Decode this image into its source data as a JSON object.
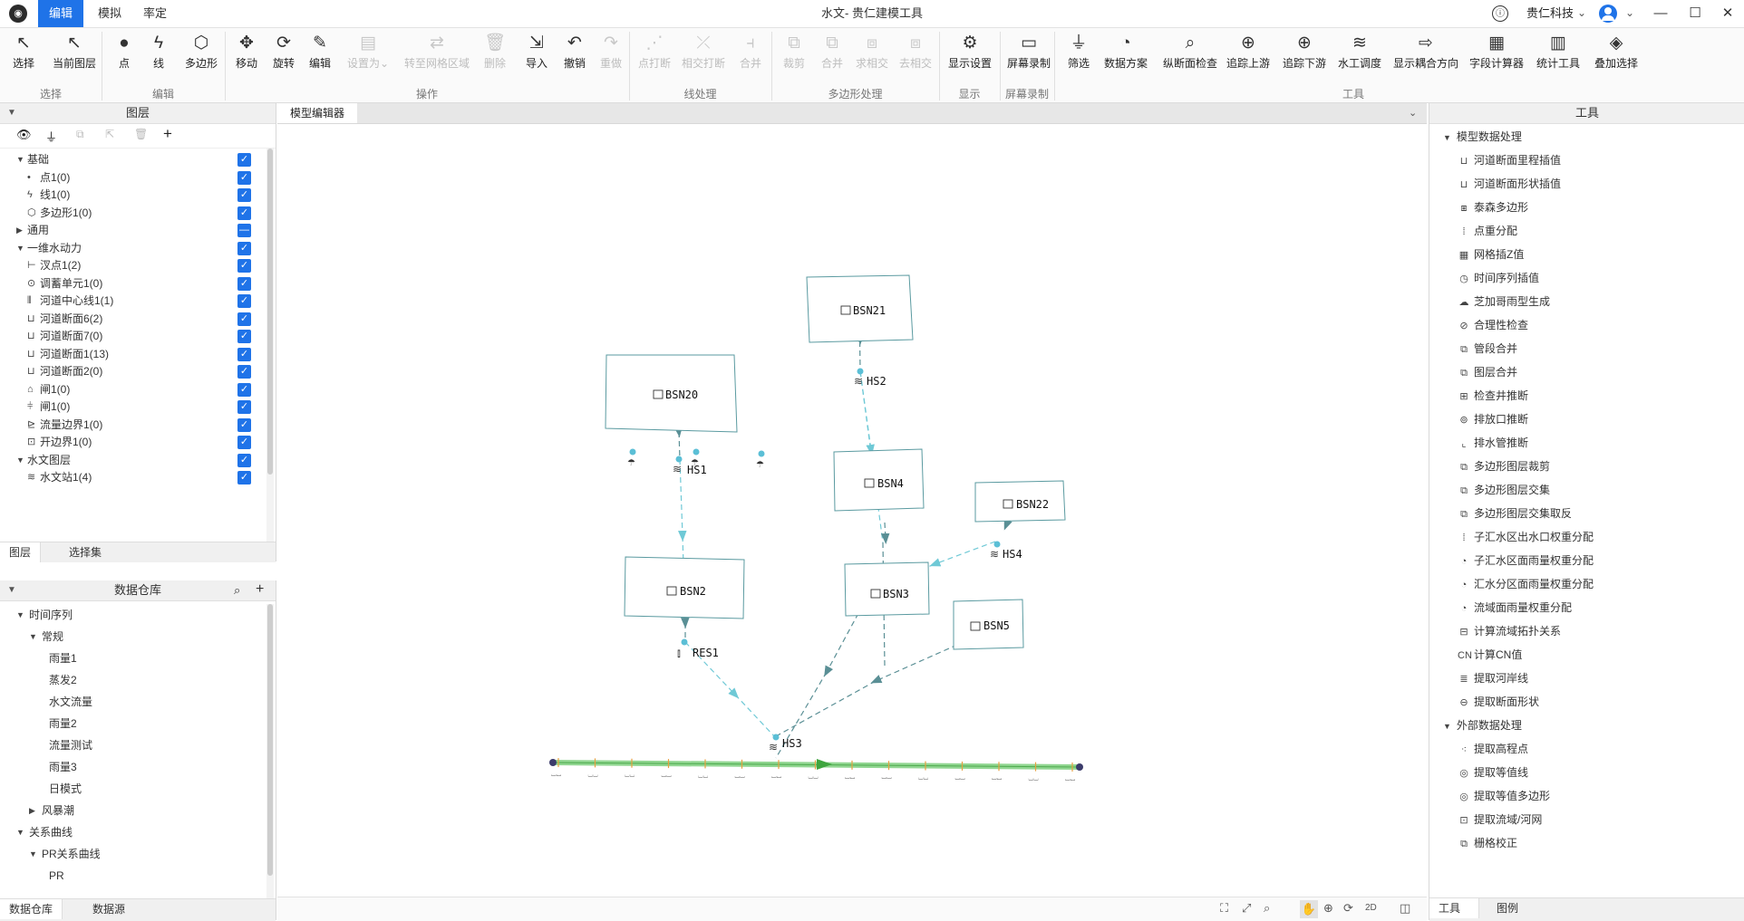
{
  "titlebar": {
    "menu": [
      "编辑",
      "模拟",
      "率定"
    ],
    "title": "水文- 贵仁建模工具",
    "company": "贵仁科技",
    "company_arrow": "⌄"
  },
  "ribbon": {
    "buttons": [
      {
        "label": "选择",
        "icon": "arrow-cursor-icon",
        "glyph": "↖",
        "disabled": false
      },
      {
        "label": "当前图层",
        "icon": "layer-cursor-icon",
        "glyph": "↖",
        "disabled": false
      },
      {
        "label": "点",
        "icon": "point-icon",
        "glyph": "●",
        "disabled": false
      },
      {
        "label": "线",
        "icon": "line-icon",
        "glyph": "ϟ",
        "disabled": false
      },
      {
        "label": "多边形",
        "icon": "polygon-icon",
        "glyph": "⬡",
        "disabled": false
      },
      {
        "label": "移动",
        "icon": "move-icon",
        "glyph": "✥",
        "disabled": false
      },
      {
        "label": "旋转",
        "icon": "rotate-icon",
        "glyph": "⟳",
        "disabled": false
      },
      {
        "label": "编辑",
        "icon": "pencil-icon",
        "glyph": "✎",
        "disabled": false
      },
      {
        "label": "设置为",
        "icon": "set-as-icon",
        "glyph": "▤",
        "disabled": true
      },
      {
        "label": "转至网格区域",
        "icon": "to-grid-icon",
        "glyph": "⇄",
        "disabled": true
      },
      {
        "label": "删除",
        "icon": "trash-icon",
        "glyph": "🗑",
        "disabled": true
      },
      {
        "label": "导入",
        "icon": "import-icon",
        "glyph": "⇲",
        "disabled": false
      },
      {
        "label": "撤销",
        "icon": "undo-icon",
        "glyph": "↶",
        "disabled": false
      },
      {
        "label": "重做",
        "icon": "redo-icon",
        "glyph": "↷",
        "disabled": true
      },
      {
        "label": "点打断",
        "icon": "point-break-icon",
        "glyph": "⋰",
        "disabled": true
      },
      {
        "label": "相交打断",
        "icon": "intersect-break-icon",
        "glyph": "⤫",
        "disabled": true
      },
      {
        "label": "合并",
        "icon": "merge-line-icon",
        "glyph": "⫞",
        "disabled": true
      },
      {
        "label": "裁剪",
        "icon": "clip-icon",
        "glyph": "⧉",
        "disabled": true
      },
      {
        "label": "合并",
        "icon": "merge-polygon-icon",
        "glyph": "⧉",
        "disabled": true
      },
      {
        "label": "求相交",
        "icon": "intersect-icon",
        "glyph": "⧈",
        "disabled": true
      },
      {
        "label": "去相交",
        "icon": "remove-intersect-icon",
        "glyph": "⧈",
        "disabled": true
      },
      {
        "label": "显示设置",
        "icon": "gear-icon",
        "glyph": "⚙",
        "disabled": false
      },
      {
        "label": "屏幕录制",
        "icon": "video-icon",
        "glyph": "▭",
        "disabled": false
      },
      {
        "label": "筛选",
        "icon": "filter-icon",
        "glyph": "⏚",
        "disabled": false
      },
      {
        "label": "数据方案",
        "icon": "pie-icon",
        "glyph": "◔",
        "disabled": false
      },
      {
        "label": "纵断面检查",
        "icon": "profile-check-icon",
        "glyph": "⌕",
        "disabled": false
      },
      {
        "label": "追踪上游",
        "icon": "trace-up-icon",
        "glyph": "⊕",
        "disabled": false
      },
      {
        "label": "追踪下游",
        "icon": "trace-down-icon",
        "glyph": "⊕",
        "disabled": false
      },
      {
        "label": "水工调度",
        "icon": "dispatch-icon",
        "glyph": "≋",
        "disabled": false
      },
      {
        "label": "显示耦合方向",
        "icon": "coupling-icon",
        "glyph": "⇨",
        "disabled": false
      },
      {
        "label": "字段计算器",
        "icon": "calculator-icon",
        "glyph": "▦",
        "disabled": false
      },
      {
        "label": "统计工具",
        "icon": "bar-chart-icon",
        "glyph": "▥",
        "disabled": false
      },
      {
        "label": "叠加选择",
        "icon": "stack-icon",
        "glyph": "◈",
        "disabled": false
      }
    ],
    "set_as_arrow": "⌄",
    "groups": [
      "选择",
      "编辑",
      "操作",
      "线处理",
      "多边形处理",
      "显示",
      "屏幕录制",
      "工具"
    ]
  },
  "layers": {
    "title": "图层",
    "items": [
      {
        "label": "基础",
        "kind": "group",
        "expand": "▼",
        "check": "✓"
      },
      {
        "label": "点1(0)",
        "glyph": "•",
        "check": "✓"
      },
      {
        "label": "线1(0)",
        "glyph": "ϟ",
        "check": "✓"
      },
      {
        "label": "多边形1(0)",
        "glyph": "⬡",
        "check": "✓"
      },
      {
        "label": "通用",
        "kind": "group",
        "expand": "▶",
        "check": "—"
      },
      {
        "label": "一维水动力",
        "kind": "group",
        "expand": "▼",
        "check": "✓"
      },
      {
        "label": "汊点1(2)",
        "glyph": "⊢",
        "check": "✓"
      },
      {
        "label": "调蓄单元1(0)",
        "glyph": "⊙",
        "check": "✓"
      },
      {
        "label": "河道中心线1(1)",
        "glyph": "⫴",
        "check": "✓"
      },
      {
        "label": "河道断面6(2)",
        "glyph": "⊔",
        "check": "✓"
      },
      {
        "label": "河道断面7(0)",
        "glyph": "⊔",
        "check": "✓"
      },
      {
        "label": "河道断面1(13)",
        "glyph": "⊔",
        "check": "✓"
      },
      {
        "label": "河道断面2(0)",
        "glyph": "⊔",
        "check": "✓"
      },
      {
        "label": "闸1(0)",
        "glyph": "⌂",
        "check": "✓"
      },
      {
        "label": "闸1(0)",
        "glyph": "⫩",
        "check": "✓"
      },
      {
        "label": "流量边界1(0)",
        "glyph": "⊵",
        "check": "✓"
      },
      {
        "label": "开边界1(0)",
        "glyph": "⊡",
        "check": "✓"
      },
      {
        "label": "水文图层",
        "kind": "group",
        "expand": "▼",
        "check": "✓"
      },
      {
        "label": "水文站1(4)",
        "glyph": "≋",
        "check": "✓"
      }
    ],
    "tabs": [
      "图层",
      "选择集"
    ]
  },
  "warehouse": {
    "title": "数据仓库",
    "items": [
      {
        "label": "时间序列",
        "level": 0,
        "expand": "▼"
      },
      {
        "label": "常规",
        "level": 1,
        "expand": "▼"
      },
      {
        "label": "雨量1",
        "level": 2
      },
      {
        "label": "蒸发2",
        "level": 2
      },
      {
        "label": "水文流量",
        "level": 2
      },
      {
        "label": "雨量2",
        "level": 2
      },
      {
        "label": "流量测试",
        "level": 2
      },
      {
        "label": "雨量3",
        "level": 2
      },
      {
        "label": "日模式",
        "level": 2
      },
      {
        "label": "风暴潮",
        "level": 1,
        "expand": "▶"
      },
      {
        "label": "关系曲线",
        "level": 0,
        "expand": "▼"
      },
      {
        "label": "PR关系曲线",
        "level": 1,
        "expand": "▼"
      },
      {
        "label": "PR",
        "level": 2
      }
    ],
    "tabs": [
      "数据仓库",
      "数据源"
    ]
  },
  "editor": {
    "tab": "模型编辑器",
    "nodes": {
      "BSN21": "BSN21",
      "BSN20": "BSN20",
      "BSN4": "BSN4",
      "BSN22": "BSN22",
      "BSN2": "BSN2",
      "BSN3": "BSN3",
      "BSN5": "BSN5",
      "HS1": "HS1",
      "HS2": "HS2",
      "HS3": "HS3",
      "HS4": "HS4",
      "RES1": "RES1"
    },
    "view_mode": "2D"
  },
  "tools": {
    "title": "工具",
    "sections": [
      {
        "title": "模型数据处理",
        "items": [
          {
            "label": "河道断面里程插值",
            "glyph": "⊔"
          },
          {
            "label": "河道断面形状插值",
            "glyph": "⊔"
          },
          {
            "label": "泰森多边形",
            "glyph": "⧆"
          },
          {
            "label": "点重分配",
            "glyph": "⁞"
          },
          {
            "label": "网格插Z值",
            "glyph": "▦"
          },
          {
            "label": "时间序列插值",
            "glyph": "◷"
          },
          {
            "label": "芝加哥雨型生成",
            "glyph": "☁"
          },
          {
            "label": "合理性检查",
            "glyph": "⊘"
          },
          {
            "label": "管段合并",
            "glyph": "⧉"
          },
          {
            "label": "图层合并",
            "glyph": "⧉"
          },
          {
            "label": "检查井推断",
            "glyph": "⊞"
          },
          {
            "label": "排放口推断",
            "glyph": "⊚"
          },
          {
            "label": "排水管推断",
            "glyph": "⌞"
          },
          {
            "label": "多边形图层裁剪",
            "glyph": "⧉"
          },
          {
            "label": "多边形图层交集",
            "glyph": "⧉"
          },
          {
            "label": "多边形图层交集取反",
            "glyph": "⧉"
          },
          {
            "label": "子汇水区出水口权重分配",
            "glyph": "⁞"
          },
          {
            "label": "子汇水区面雨量权重分配",
            "glyph": "◔"
          },
          {
            "label": "汇水分区面雨量权重分配",
            "glyph": "◔"
          },
          {
            "label": "流域面雨量权重分配",
            "glyph": "◔"
          },
          {
            "label": "计算流域拓扑关系",
            "glyph": "⊟"
          },
          {
            "label": "计算CN值",
            "glyph": "CN"
          },
          {
            "label": "提取河岸线",
            "glyph": "≣"
          },
          {
            "label": "提取断面形状",
            "glyph": "⊖"
          }
        ]
      },
      {
        "title": "外部数据处理",
        "items": [
          {
            "label": "提取高程点",
            "glyph": "⁖"
          },
          {
            "label": "提取等值线",
            "glyph": "◎"
          },
          {
            "label": "提取等值多边形",
            "glyph": "◎"
          },
          {
            "label": "提取流域/河网",
            "glyph": "⊡"
          },
          {
            "label": "栅格校正",
            "glyph": "⧉"
          }
        ]
      }
    ],
    "tabs": [
      "工具",
      "图例"
    ]
  },
  "colors": {
    "accent": "#1f73e8",
    "node_box": "#5a9aa0",
    "flow": "#6fc9d6",
    "river": "#7ed07e"
  }
}
